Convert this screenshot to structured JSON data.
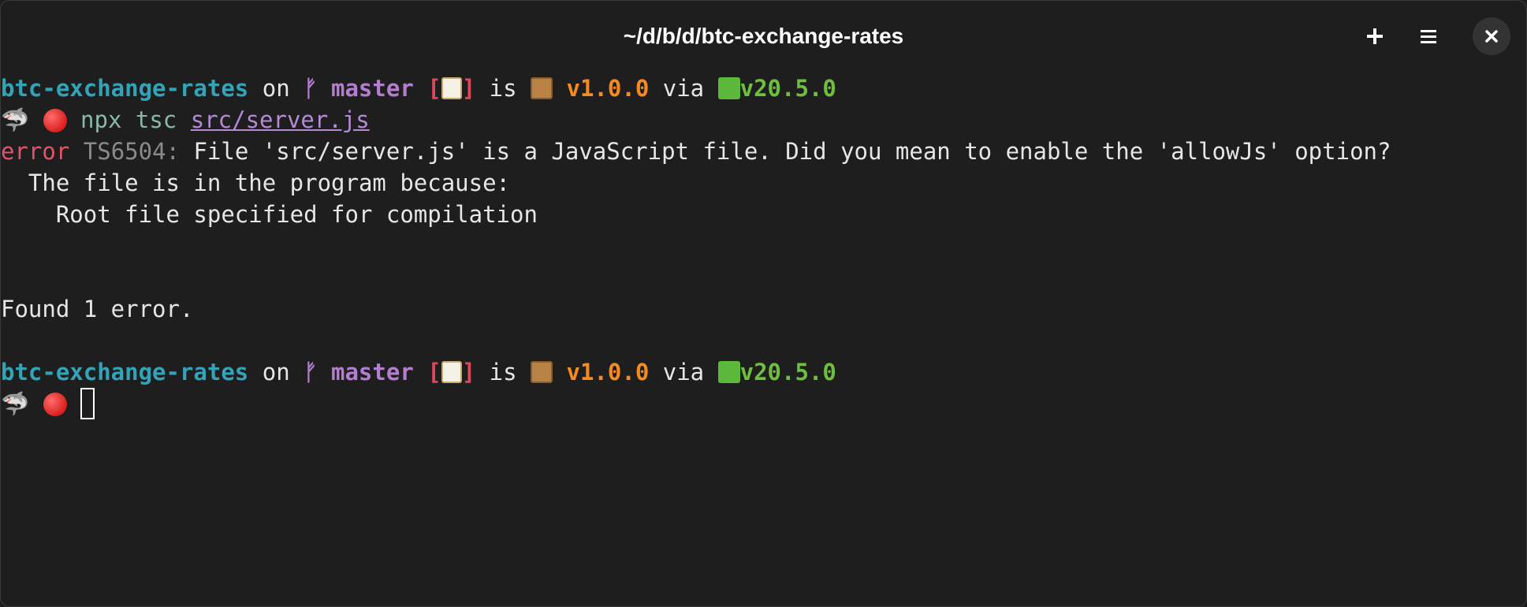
{
  "window": {
    "title": "~/d/b/d/btc-exchange-rates",
    "new_tab_label": "+",
    "menu_label": "☰",
    "close_label": "✕"
  },
  "prompt": {
    "directory": "btc-exchange-rates",
    "on": "on",
    "branch_symbol": "ᚠ",
    "branch": "master",
    "status_open": "[",
    "status_close": "]",
    "is": "is",
    "version": "v1.0.0",
    "via": "via",
    "node_version": "v20.5.0",
    "shark_glyph": "🦈"
  },
  "command": {
    "name": "npx tsc",
    "arg": "src/server.js"
  },
  "output": {
    "error_word": "error",
    "error_code": "TS6504:",
    "error_message": "File 'src/server.js' is a JavaScript file. Did you mean to enable the 'allowJs' option?",
    "line2": "  The file is in the program because:",
    "line3": "    Root file specified for compilation",
    "summary": "Found 1 error."
  },
  "colors": {
    "directory": "#33a4b8",
    "branch": "#b47ed0",
    "status": "#e0465a",
    "version": "#f58a20",
    "node": "#6fbf3f",
    "error": "#e05568",
    "background": "#1e1e1e"
  },
  "icons": [
    "git-branch-icon",
    "memo-icon",
    "package-icon",
    "nodejs-icon",
    "shark-icon",
    "red-circle-icon",
    "plus-icon",
    "menu-icon",
    "close-icon"
  ]
}
